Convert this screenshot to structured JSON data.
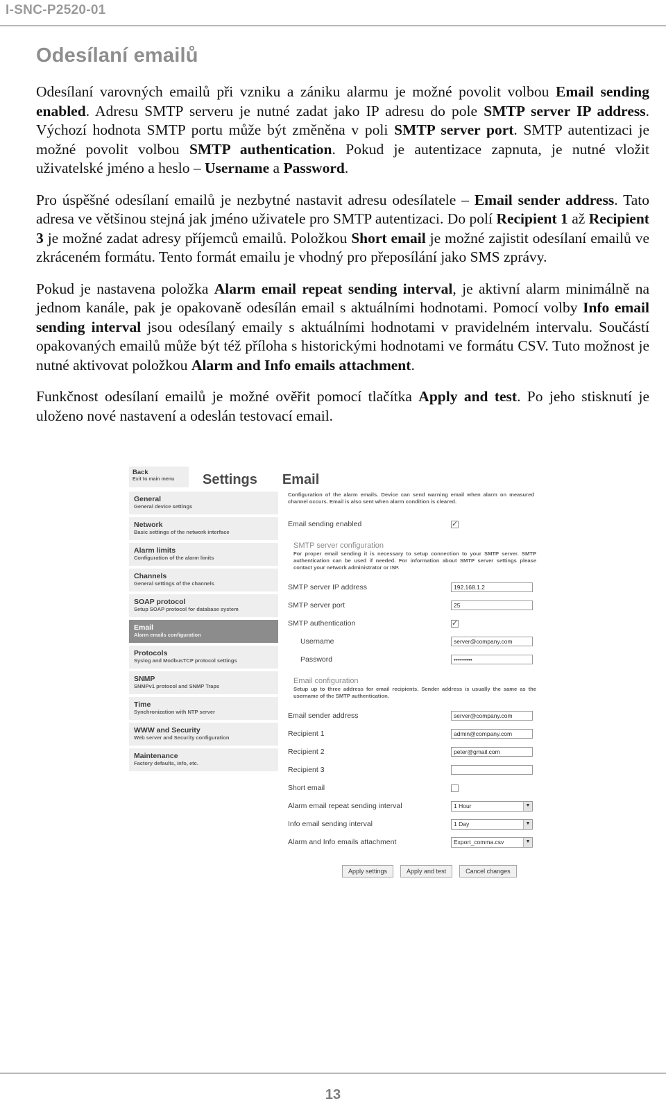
{
  "header": {
    "document_code": "I-SNC-P2520-01"
  },
  "section": {
    "title": "Odesílaní emailů",
    "paragraphs": [
      [
        {
          "t": "Odesílaní varovných emailů při vzniku a zániku alarmu je možné povolit volbou ",
          "b": false
        },
        {
          "t": "Email sending enabled",
          "b": true
        },
        {
          "t": ". Adresu SMTP serveru je nutné zadat jako IP adresu do pole ",
          "b": false
        },
        {
          "t": "SMTP server IP address",
          "b": true
        },
        {
          "t": ". Výchozí hodnota SMTP portu může být změněna v poli ",
          "b": false
        },
        {
          "t": "SMTP server port",
          "b": true
        },
        {
          "t": ". SMTP autentizaci je možné povolit volbou ",
          "b": false
        },
        {
          "t": "SMTP authentication",
          "b": true
        },
        {
          "t": ". Pokud je autentizace zapnuta, je nutné vložit uživatelské jméno a heslo – ",
          "b": false
        },
        {
          "t": "Username",
          "b": true
        },
        {
          "t": " a ",
          "b": false
        },
        {
          "t": "Password",
          "b": true
        },
        {
          "t": ".",
          "b": false
        }
      ],
      [
        {
          "t": "Pro úspěšné odesílaní emailů je nezbytné nastavit adresu odesílatele – ",
          "b": false
        },
        {
          "t": "Email sender address",
          "b": true
        },
        {
          "t": ". Tato adresa ve většinou stejná jak jméno uživatele pro SMTP autentizaci. Do polí ",
          "b": false
        },
        {
          "t": "Recipient 1",
          "b": true
        },
        {
          "t": " až ",
          "b": false
        },
        {
          "t": "Recipient 3",
          "b": true
        },
        {
          "t": " je možné zadat adresy příjemců emailů. Položkou ",
          "b": false
        },
        {
          "t": "Short email",
          "b": true
        },
        {
          "t": " je možné zajistit odesílaní emailů ve zkráceném formátu. Tento formát emailu je vhodný pro přeposílání jako SMS zprávy.",
          "b": false
        }
      ],
      [
        {
          "t": "Pokud je nastavena položka ",
          "b": false
        },
        {
          "t": "Alarm email repeat sending interval",
          "b": true
        },
        {
          "t": ", je aktivní alarm minimálně na jednom kanále, pak je opakovaně odesílán email s aktuálními hodnotami. Pomocí volby ",
          "b": false
        },
        {
          "t": "Info email sending interval",
          "b": true
        },
        {
          "t": " jsou odesílaný emaily s aktuálními hodnotami v pravidelném intervalu. Součástí opakovaných emailů může být též příloha s historickými hodnotami ve formátu CSV. Tuto možnost je nutné aktivovat položkou ",
          "b": false
        },
        {
          "t": "Alarm and Info emails attachment",
          "b": true
        },
        {
          "t": ".",
          "b": false
        }
      ],
      [
        {
          "t": "Funkčnost odesílaní emailů je možné ověřit pomocí tlačítka ",
          "b": false
        },
        {
          "t": "Apply and test",
          "b": true
        },
        {
          "t": ". Po jeho stisknutí je uloženo nové nastavení a odeslán testovací email.",
          "b": false
        }
      ]
    ]
  },
  "figure": {
    "back_button": {
      "title": "Back",
      "subtitle": "Exit to main menu"
    },
    "heading_primary": "Settings",
    "heading_secondary": "Email",
    "sidebar": [
      {
        "title": "General",
        "subtitle": "General device settings",
        "selected": false
      },
      {
        "title": "Network",
        "subtitle": "Basic settings of the network interface",
        "selected": false
      },
      {
        "title": "Alarm limits",
        "subtitle": "Configuration of the alarm limits",
        "selected": false
      },
      {
        "title": "Channels",
        "subtitle": "General settings of the channels",
        "selected": false
      },
      {
        "title": "SOAP protocol",
        "subtitle": "Setup SOAP protocol for database system",
        "selected": false
      },
      {
        "title": "Email",
        "subtitle": "Alarm emails configuration",
        "selected": true
      },
      {
        "title": "Protocols",
        "subtitle": "Syslog and ModbusTCP protocol settings",
        "selected": false
      },
      {
        "title": "SNMP",
        "subtitle": "SNMPv1 protocol and SNMP Traps",
        "selected": false
      },
      {
        "title": "Time",
        "subtitle": "Synchronization with NTP server",
        "selected": false
      },
      {
        "title": "WWW and Security",
        "subtitle": "Web server and Security configuration",
        "selected": false
      },
      {
        "title": "Maintenance",
        "subtitle": "Factory defaults, info, etc.",
        "selected": false
      }
    ],
    "panel": {
      "description": "Configuration of the alarm emails. Device can send warning email when alarm on measured channel occurs. Email is also sent when alarm condition is cleared.",
      "email_sending_enabled": {
        "label": "Email sending enabled",
        "checked": true
      },
      "smtp_group": {
        "title": "SMTP server configuration",
        "description": "For proper email sending it is necessary to setup connection to your SMTP server. SMTP authentication can be used if needed. For information about SMTP server settings please contact your network administrator or ISP.",
        "fields": [
          {
            "label": "SMTP server IP address",
            "type": "text",
            "value": "192.168.1.2",
            "indent": false
          },
          {
            "label": "SMTP server port",
            "type": "text",
            "value": "25",
            "indent": false
          },
          {
            "label": "SMTP authentication",
            "type": "checkbox",
            "checked": true,
            "indent": false
          },
          {
            "label": "Username",
            "type": "text",
            "value": "server@company.com",
            "indent": true
          },
          {
            "label": "Password",
            "type": "text",
            "value": "•••••••••",
            "indent": true
          }
        ]
      },
      "email_group": {
        "title": "Email configuration",
        "description": "Setup up to three address for email recipients. Sender address is usually the same as the username of the SMTP authentication.",
        "fields": [
          {
            "label": "Email sender address",
            "type": "text",
            "value": "server@company.com",
            "indent": false
          },
          {
            "label": "Recipient 1",
            "type": "text",
            "value": "admin@company.com",
            "indent": false
          },
          {
            "label": "Recipient 2",
            "type": "text",
            "value": "peter@gmail.com",
            "indent": false
          },
          {
            "label": "Recipient 3",
            "type": "text",
            "value": "",
            "indent": false
          },
          {
            "label": "Short email",
            "type": "checkbox",
            "checked": false,
            "indent": false
          },
          {
            "label": "Alarm email repeat sending interval",
            "type": "select",
            "value": "1 Hour",
            "indent": false
          },
          {
            "label": "Info email sending interval",
            "type": "select",
            "value": "1 Day",
            "indent": false
          },
          {
            "label": "Alarm and Info emails attachment",
            "type": "select",
            "value": "Export_comma.csv",
            "indent": false
          }
        ]
      },
      "buttons": [
        "Apply settings",
        "Apply and test",
        "Cancel changes"
      ]
    }
  },
  "footer": {
    "page_number": "13"
  }
}
